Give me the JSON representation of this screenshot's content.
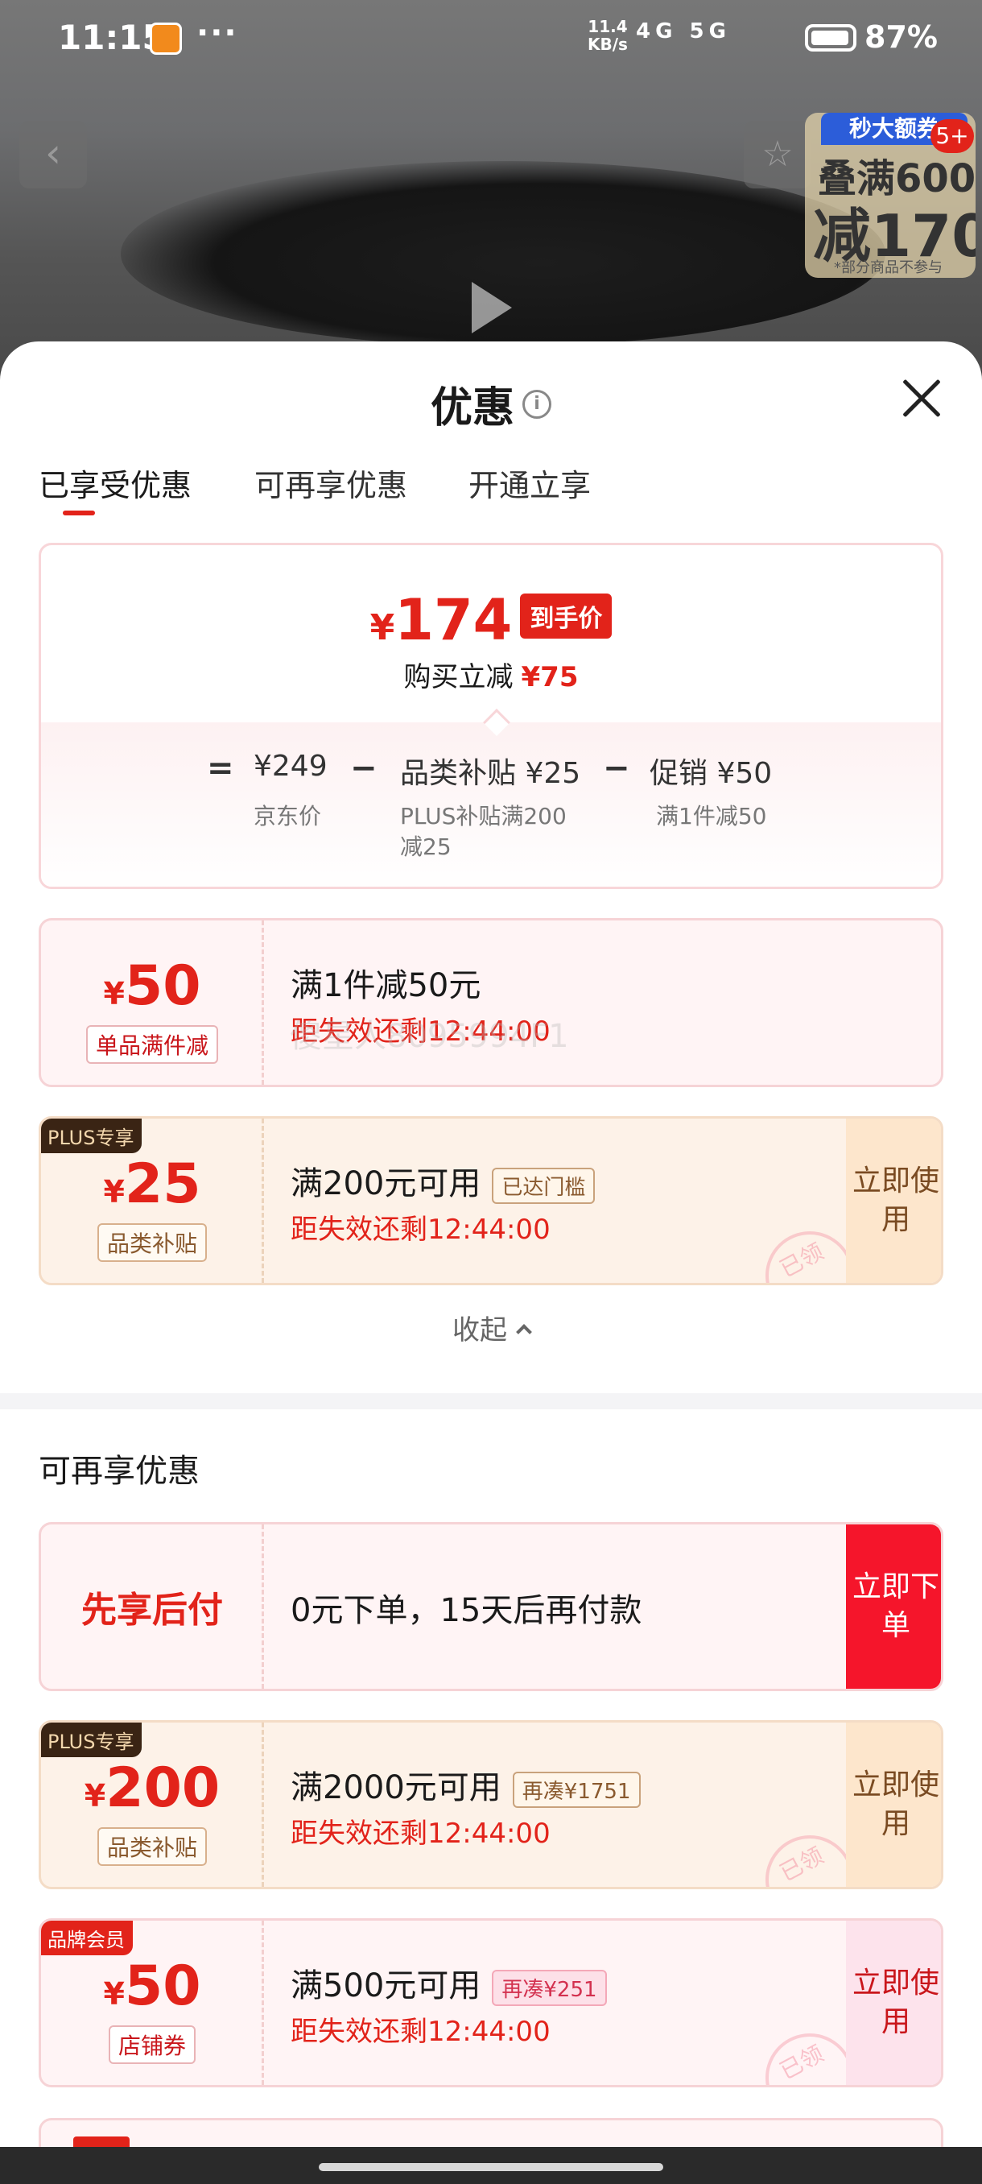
{
  "status_bar": {
    "time": "11:15",
    "more": "···",
    "net_speed": "11.4",
    "net_speed_unit": "KB/s",
    "signal": "4G 5G",
    "battery": "87%"
  },
  "promo": {
    "top_label": "秒大额券",
    "count": "5+",
    "line1": "叠满600",
    "line2": "减170",
    "note": "*部分商品不参与"
  },
  "sheet": {
    "title": "优惠",
    "tabs": [
      "已享受优惠",
      "可再享优惠",
      "开通立享"
    ]
  },
  "summary": {
    "currency": "¥",
    "final_price": "174",
    "final_tag": "到手价",
    "save_label": "购买立减",
    "save_amount": "¥75",
    "eq": "=",
    "minus": "−",
    "base_price": "¥249",
    "base_label": "京东价",
    "subsidy": "品类补贴 ¥25",
    "subsidy_label_1": "PLUS补贴满200",
    "subsidy_label_2": "减25",
    "promo": "促销 ¥50",
    "promo_label": "满1件减50"
  },
  "enjoyed_coupons": [
    {
      "currency": "¥",
      "amount": "50",
      "type": "单品满件减",
      "title": "满1件减50元",
      "timer": "距失效还剩12:44:00"
    },
    {
      "badge": "PLUS专享",
      "currency": "¥",
      "amount": "25",
      "type": "品类补贴",
      "title": "满200元可用",
      "chip": "已达门槛",
      "timer": "距失效还剩12:44:00",
      "action": "立即使用",
      "stamp": "已领"
    }
  ],
  "watermark": "傻星人8095994F1",
  "collapse_label": "收起",
  "more_section": {
    "title": "可再享优惠",
    "bnpl": {
      "title": "先享后付",
      "desc": "0元下单，15天后再付款",
      "action": "立即下单"
    },
    "coupons": [
      {
        "badge": "PLUS专享",
        "currency": "¥",
        "amount": "200",
        "type": "品类补贴",
        "title": "满2000元可用",
        "chip": "再凑¥1751",
        "timer": "距失效还剩12:44:00",
        "action": "立即使用",
        "stamp": "已领"
      },
      {
        "badge": "品牌会员",
        "currency": "¥",
        "amount": "50",
        "type": "店铺券",
        "title": "满500元可用",
        "chip": "再凑¥251",
        "timer": "距失效还剩12:44:00",
        "action": "立即使用",
        "stamp": "已领"
      }
    ]
  },
  "colors": {
    "accent_red": "#e2231a",
    "plus_dark": "#3a2414",
    "plus_bg": "#fdf2e8",
    "coupon_bg": "#fff4f5"
  }
}
